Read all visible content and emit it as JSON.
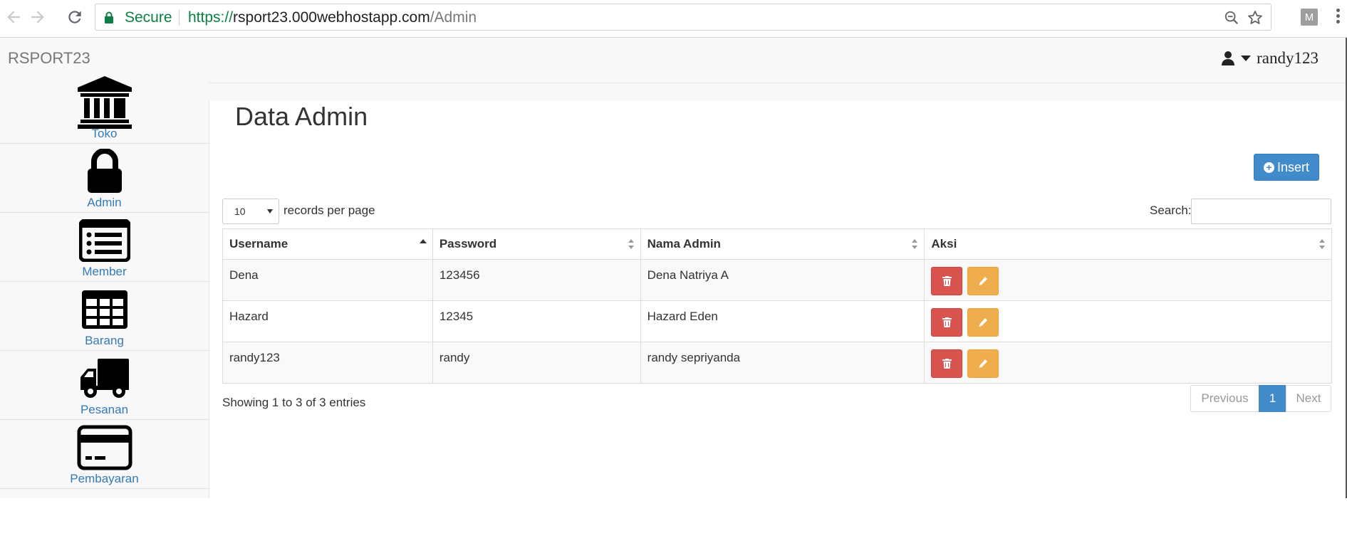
{
  "browser": {
    "secure_label": "Secure",
    "url_proto": "https://",
    "url_host": "rsport23.000webhostapp.com",
    "url_path": "/Admin",
    "profile_initial": "M"
  },
  "header": {
    "brand": "RSPORT23",
    "user_name": "randy123"
  },
  "sidebar": {
    "items": [
      {
        "label": "Toko",
        "icon": "bank-icon"
      },
      {
        "label": "Admin",
        "icon": "lock-icon"
      },
      {
        "label": "Member",
        "icon": "list-alt-icon"
      },
      {
        "label": "Barang",
        "icon": "table-icon"
      },
      {
        "label": "Pesanan",
        "icon": "truck-icon"
      },
      {
        "label": "Pembayaran",
        "icon": "credit-card-icon"
      }
    ]
  },
  "main": {
    "title": "Data Admin",
    "insert_label": "Insert",
    "page_length": "10",
    "page_length_label": "records per page",
    "search_label": "Search:",
    "search_value": "",
    "columns": [
      "Username",
      "Password",
      "Nama Admin",
      "Aksi"
    ],
    "rows": [
      {
        "username": "Dena",
        "password": "123456",
        "nama": "Dena Natriya A"
      },
      {
        "username": "Hazard",
        "password": "12345",
        "nama": "Hazard Eden"
      },
      {
        "username": "randy123",
        "password": "randy",
        "nama": "randy sepriyanda"
      }
    ],
    "info": "Showing 1 to 3 of 3 entries",
    "pagination": {
      "previous": "Previous",
      "current": "1",
      "next": "Next"
    }
  },
  "colors": {
    "primary": "#428bca",
    "danger": "#d9534f",
    "warning": "#f0ad4e",
    "link": "#337ab7",
    "secure_green": "#0b8043"
  }
}
